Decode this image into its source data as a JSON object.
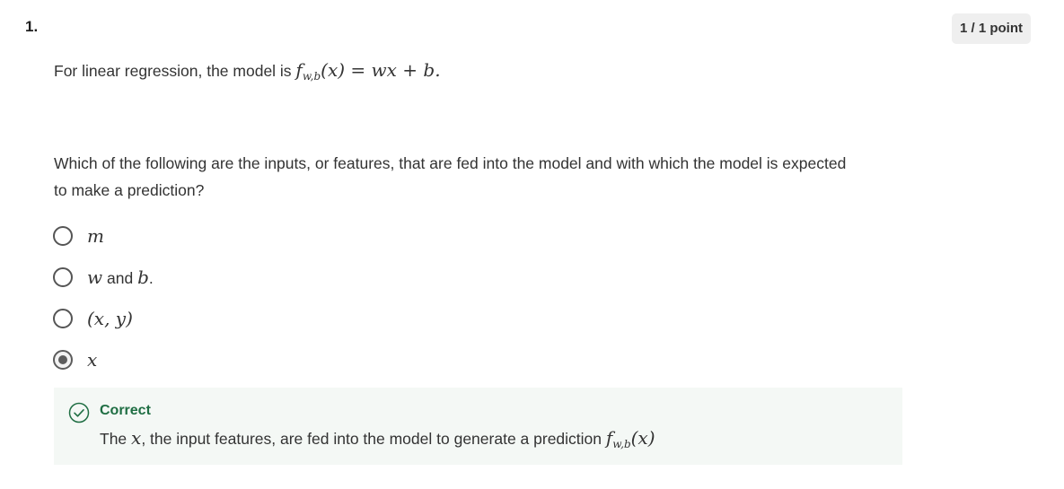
{
  "question": {
    "number": "1.",
    "points": "1 / 1 point",
    "stem_prefix": "For linear regression, the model is ",
    "model_func": "f",
    "model_sub": "w,b",
    "model_arg": "(x)",
    "model_rhs": " = wx + b.",
    "text": "Which of the following are the inputs, or features, that are fed into the model and with which the model is expected to make a prediction?"
  },
  "options": [
    {
      "math": "m",
      "suffix": "",
      "selected": false
    },
    {
      "math": "w",
      "mid": " and ",
      "math2": "b",
      "suffix": ".",
      "selected": false
    },
    {
      "math": "(x, y)",
      "suffix": "",
      "selected": false
    },
    {
      "math": "x",
      "suffix": "",
      "selected": true
    }
  ],
  "feedback": {
    "status": "Correct",
    "text_prefix": "The ",
    "text_var": "x",
    "text_mid": ", the input features, are fed into the model to generate a prediction ",
    "pred_func": "f",
    "pred_sub": "w,b",
    "pred_arg": "(x)",
    "icon": "check-circle-icon",
    "accent_color": "#1f6e43",
    "bg_color": "#f4f8f5"
  }
}
